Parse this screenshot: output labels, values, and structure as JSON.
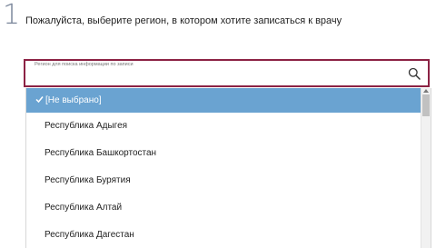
{
  "step": {
    "number": "1",
    "heading": "Пожалуйста, выберите регион, в котором хотите записаться к врачу"
  },
  "region_field": {
    "label": "Регион для поиска информации по записи",
    "value": "",
    "icon": "search-icon"
  },
  "dropdown": {
    "selected_label": "[Не выбрано]",
    "options": [
      "Республика Адыгея",
      "Республика Башкортостан",
      "Республика Бурятия",
      "Республика Алтай",
      "Республика Дагестан"
    ]
  },
  "colors": {
    "field_border": "#8c2244",
    "selected_background": "#6aa3d1"
  }
}
